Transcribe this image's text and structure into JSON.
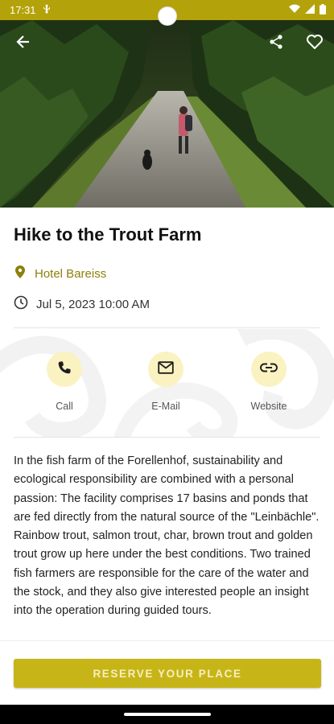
{
  "status_bar": {
    "time": "17:31",
    "left_icons": [
      "usb-icon"
    ],
    "right_icons": [
      "wifi-icon",
      "signal-icon",
      "battery-icon"
    ]
  },
  "hero": {
    "back_icon": "arrow-left-icon",
    "share_icon": "share-icon",
    "favorite_icon": "heart-outline-icon"
  },
  "event": {
    "title": "Hike to the Trout Farm",
    "location": "Hotel Bareiss",
    "datetime": "Jul 5, 2023 10:00 AM"
  },
  "actions": [
    {
      "label": "Call",
      "icon": "phone-icon"
    },
    {
      "label": "E-Mail",
      "icon": "mail-icon"
    },
    {
      "label": "Website",
      "icon": "link-icon"
    }
  ],
  "description": "In the fish farm of the Forellenhof, sustainability and ecological responsibility are combined with a personal passion: The facility comprises 17 basins and ponds that are fed directly from the natural source of the \"Leinbächle\". Rainbow trout, salmon trout, char, brown trout and golden trout grow up here under the best conditions. Two trained fish farmers are responsible for the care of the water and the stock, and they also give interested people an insight into the operation during guided tours.",
  "reserve": {
    "label": "RESERVE YOUR PLACE"
  },
  "colors": {
    "accent": "#b4a20a",
    "button": "#c7b517",
    "icon_circle": "#fbf2c2",
    "location_text": "#8d7f08"
  }
}
